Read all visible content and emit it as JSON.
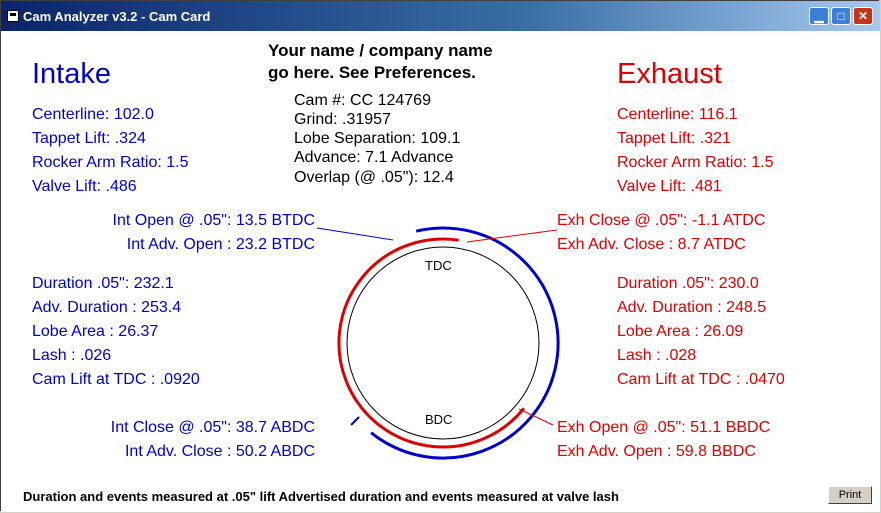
{
  "window": {
    "title": "Cam Analyzer v3.2 - Cam Card"
  },
  "company": {
    "line1": "Your name / company name",
    "line2": "go here.  See Preferences."
  },
  "cam": {
    "number": "Cam #:  CC 124769",
    "grind": "Grind:  .31957",
    "lobe_separation": "Lobe Separation: 109.1",
    "advance": "Advance: 7.1  Advance",
    "overlap": "Overlap (@ .05\"): 12.4"
  },
  "intake": {
    "heading": "Intake",
    "centerline": "Centerline: 102.0",
    "tappet_lift": "Tappet Lift: .324",
    "rocker_ratio": "Rocker Arm Ratio: 1.5",
    "valve_lift": "Valve Lift: .486",
    "open": "Int Open @ .05\": 13.5 BTDC",
    "adv_open": "Int Adv. Open : 23.2 BTDC",
    "duration": "Duration .05\": 232.1",
    "adv_duration": "Adv. Duration : 253.4",
    "lobe_area": "Lobe Area : 26.37",
    "lash": "Lash : .026",
    "cam_lift_tdc": "Cam Lift at TDC : .0920",
    "close": "Int Close @ .05\": 38.7 ABDC",
    "adv_close": "Int Adv. Close : 50.2 ABDC"
  },
  "exhaust": {
    "heading": "Exhaust",
    "centerline": "Centerline: 116.1",
    "tappet_lift": "Tappet Lift: .321",
    "rocker_ratio": "Rocker Arm Ratio: 1.5",
    "valve_lift": "Valve Lift: .481",
    "close": "Exh Close @ .05\": -1.1 ATDC",
    "adv_close": "Exh Adv. Close : 8.7 ATDC",
    "duration": "Duration .05\": 230.0",
    "adv_duration": "Adv. Duration : 248.5",
    "lobe_area": "Lobe Area : 26.09",
    "lash": "Lash : .028",
    "cam_lift_tdc": "Cam Lift at TDC : .0470",
    "open": "Exh Open @ .05\": 51.1 BBDC",
    "adv_open": "Exh Adv. Open : 59.8 BBDC"
  },
  "diagram": {
    "tdc_label": "TDC",
    "bdc_label": "BDC"
  },
  "footer": {
    "note": "Duration and events measured at .05\" lift    Advertised duration and events measured at valve lash"
  },
  "buttons": {
    "print": "Print"
  },
  "colors": {
    "intake": "#0000cc",
    "exhaust": "#dd0000",
    "titlebar": "#0a246a"
  }
}
